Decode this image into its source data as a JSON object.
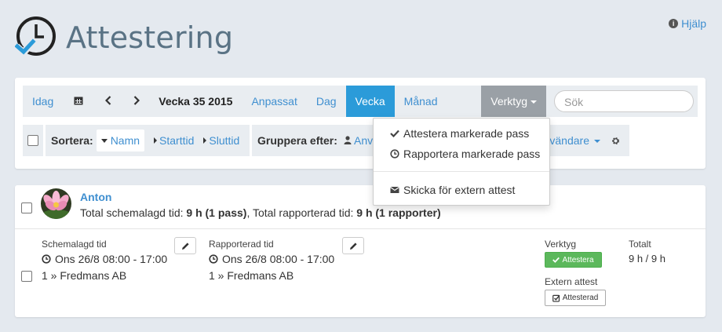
{
  "header": {
    "title": "Attestering",
    "help_label": "Hjälp"
  },
  "toolbar": {
    "today": "Idag",
    "week_label": "Vecka 35 2015",
    "views": [
      "Anpassat",
      "Dag",
      "Vecka",
      "Månad"
    ],
    "tools_label": "Verktyg",
    "search_placeholder": "Sök"
  },
  "sortbar": {
    "sort_label": "Sortera:",
    "options": [
      "Namn",
      "Starttid",
      "Sluttid"
    ],
    "group_label": "Gruppera efter:",
    "group_value": "Anv",
    "group_value2": "nvändare"
  },
  "dropdown": {
    "items": [
      "Attestera markerade pass",
      "Rapportera markerade pass",
      "Skicka för extern attest"
    ]
  },
  "employee": {
    "name": "Anton",
    "summary_prefix": "Total schemalagd tid: ",
    "scheduled_total": "9 h (1 pass)",
    "summary_mid": ", Total rapporterad tid: ",
    "reported_total": "9 h (1 rapporter)",
    "scheduled_label": "Schemalagd tid",
    "scheduled_time": "Ons 26/8 08:00 - 17:00",
    "scheduled_place": "1 » Fredmans AB",
    "reported_label": "Rapporterad tid",
    "reported_time": "Ons 26/8 08:00 - 17:00",
    "reported_place": "1 » Fredmans AB",
    "tools_label": "Verktyg",
    "attest_button": "Attestera",
    "total_label": "Totalt",
    "total_value": "9 h / 9 h",
    "external_label": "Extern attest",
    "external_button": "Attesterad"
  },
  "colors": {
    "accent": "#2b9bd9",
    "link": "#3f8fd0",
    "success": "#5cb85c",
    "background": "#e4e9ef"
  }
}
